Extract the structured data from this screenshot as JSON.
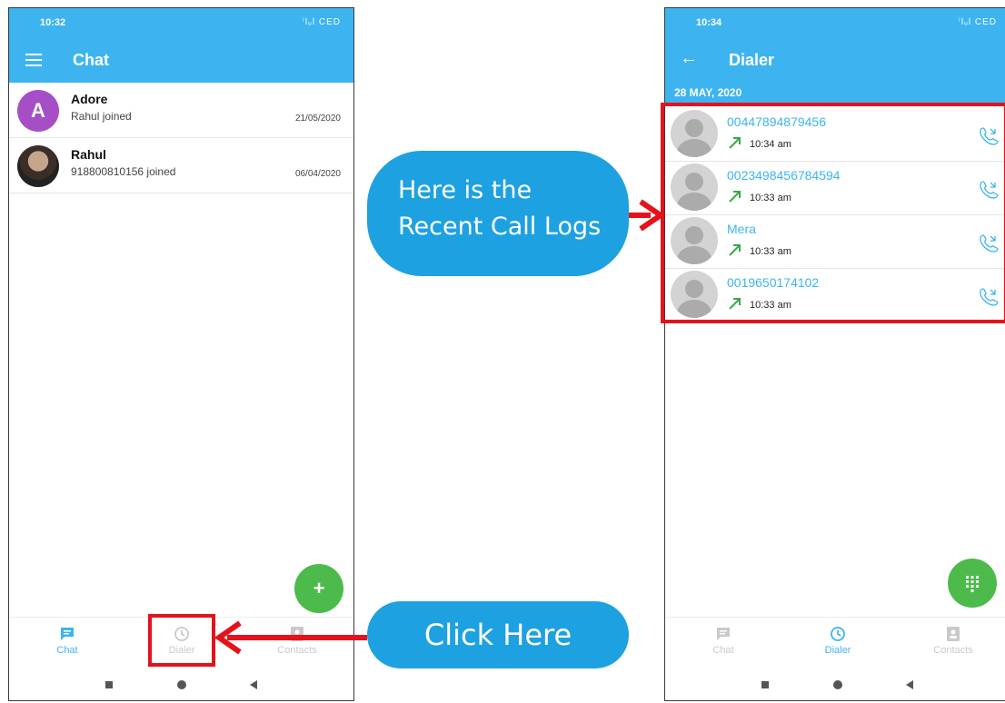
{
  "left_screen": {
    "status_time": "10:32",
    "status_icons": "ⁱlᵤl CED",
    "appbar_title": "Chat",
    "chats": [
      {
        "avatar_letter": "A",
        "name": "Adore",
        "subtitle": "Rahul joined",
        "date": "21/05/2020",
        "avatar_color": "#a64ec6"
      },
      {
        "avatar_letter": "",
        "name": "Rahul",
        "subtitle": "918800810156 joined",
        "date": "06/04/2020"
      }
    ],
    "fab_icon": "+",
    "nav": [
      {
        "label": "Chat",
        "icon": "chat-icon",
        "active": true
      },
      {
        "label": "Dialer",
        "icon": "history-icon",
        "active": false
      },
      {
        "label": "Contacts",
        "icon": "contacts-icon",
        "active": false
      }
    ]
  },
  "right_screen": {
    "status_time": "10:34",
    "status_icons": "ⁱlᵤl CED",
    "appbar_title": "Dialer",
    "date_header": "28 MAY, 2020",
    "calls": [
      {
        "number": "00447894879456",
        "time": "10:34 am",
        "direction": "outgoing"
      },
      {
        "number": "0023498456784594",
        "time": "10:33 am",
        "direction": "outgoing"
      },
      {
        "number": "Mera",
        "time": "10:33 am",
        "direction": "outgoing"
      },
      {
        "number": "0019650174102",
        "time": "10:33 am",
        "direction": "outgoing"
      }
    ],
    "fab_icon": "dialpad-icon",
    "nav": [
      {
        "label": "Chat",
        "icon": "chat-icon",
        "active": false
      },
      {
        "label": "Dialer",
        "icon": "history-icon",
        "active": true
      },
      {
        "label": "Contacts",
        "icon": "contacts-icon",
        "active": false
      }
    ]
  },
  "annotations": {
    "calllogs_line1": "Here is the",
    "calllogs_line2": "Recent Call Logs",
    "click_here": "Click Here"
  },
  "colors": {
    "primary": "#3db4f0",
    "fab": "#4cbb4b",
    "highlight": "#e5121b",
    "bubble": "#1ea1e1"
  }
}
